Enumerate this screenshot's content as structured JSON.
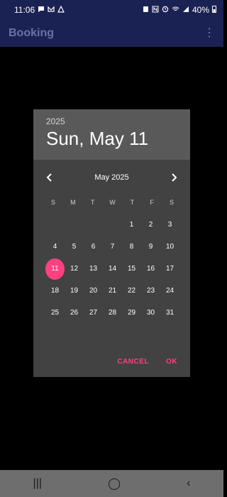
{
  "statusbar": {
    "time": "11:06",
    "battery_percent": "40%",
    "left_icons": [
      "chat-icon",
      "mail-icon",
      "privacy-icon"
    ],
    "right_icons": [
      "security-icon",
      "nfc-icon",
      "alarm-icon",
      "wifi-icon",
      "signal-icon"
    ]
  },
  "appbar": {
    "title": "Booking",
    "menu_icon": "more-vert-icon"
  },
  "dialog": {
    "header_year": "2025",
    "header_date": "Sun, May 11",
    "month_label": "May 2025",
    "weekdays": [
      "S",
      "M",
      "T",
      "W",
      "T",
      "F",
      "S"
    ],
    "days": [
      "",
      "",
      "",
      "",
      "1",
      "2",
      "3",
      "4",
      "5",
      "6",
      "7",
      "8",
      "9",
      "10",
      "11",
      "12",
      "13",
      "14",
      "15",
      "16",
      "17",
      "18",
      "19",
      "20",
      "21",
      "22",
      "23",
      "24",
      "25",
      "26",
      "27",
      "28",
      "29",
      "30",
      "31"
    ],
    "selected_day": "11",
    "cancel_label": "CANCEL",
    "ok_label": "OK",
    "accent_color": "#ff4081"
  },
  "navbar": {
    "recents_icon": "|||",
    "home_icon": "◯",
    "back_icon": "‹"
  }
}
